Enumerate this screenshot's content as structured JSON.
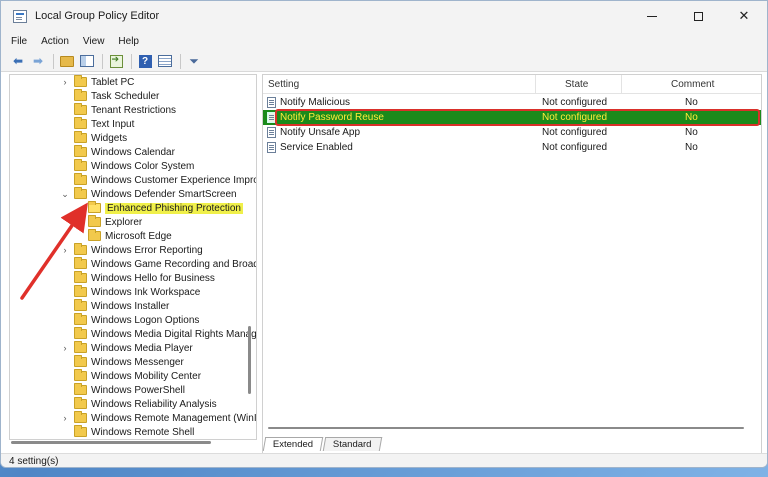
{
  "window": {
    "title": "Local Group Policy Editor",
    "controls": {
      "minimize": "—",
      "maximize": "□",
      "close": "✕"
    }
  },
  "menubar": {
    "items": [
      "File",
      "Action",
      "View",
      "Help"
    ]
  },
  "toolbar": {
    "icons": [
      "back-arrow-icon",
      "forward-arrow-icon",
      "up-folder-icon",
      "show-pane-icon",
      "export-list-icon",
      "help-icon",
      "properties-icon",
      "filter-icon"
    ]
  },
  "tree": {
    "items": [
      {
        "label": "Tablet PC",
        "expander": "›"
      },
      {
        "label": "Task Scheduler",
        "expander": ""
      },
      {
        "label": "Tenant Restrictions",
        "expander": ""
      },
      {
        "label": "Text Input",
        "expander": ""
      },
      {
        "label": "Widgets",
        "expander": ""
      },
      {
        "label": "Windows Calendar",
        "expander": ""
      },
      {
        "label": "Windows Color System",
        "expander": ""
      },
      {
        "label": "Windows Customer Experience Impro",
        "expander": ""
      },
      {
        "label": "Windows Defender SmartScreen",
        "expander": "⌄"
      },
      {
        "label": "Enhanced Phishing Protection",
        "expander": "",
        "selected": true
      },
      {
        "label": "Explorer",
        "expander": ""
      },
      {
        "label": "Microsoft Edge",
        "expander": ""
      },
      {
        "label": "Windows Error Reporting",
        "expander": "›"
      },
      {
        "label": "Windows Game Recording and Broad",
        "expander": ""
      },
      {
        "label": "Windows Hello for Business",
        "expander": ""
      },
      {
        "label": "Windows Ink Workspace",
        "expander": ""
      },
      {
        "label": "Windows Installer",
        "expander": ""
      },
      {
        "label": "Windows Logon Options",
        "expander": ""
      },
      {
        "label": "Windows Media Digital Rights Manag",
        "expander": ""
      },
      {
        "label": "Windows Media Player",
        "expander": "›"
      },
      {
        "label": "Windows Messenger",
        "expander": ""
      },
      {
        "label": "Windows Mobility Center",
        "expander": ""
      },
      {
        "label": "Windows PowerShell",
        "expander": ""
      },
      {
        "label": "Windows Reliability Analysis",
        "expander": ""
      },
      {
        "label": "Windows Remote Management (WinI",
        "expander": "›"
      },
      {
        "label": "Windows Remote Shell",
        "expander": ""
      }
    ]
  },
  "list": {
    "columns": {
      "setting": "Setting",
      "state": "State",
      "comment": "Comment"
    },
    "rows": [
      {
        "setting": "Notify Malicious",
        "state": "Not configured",
        "comment": "No"
      },
      {
        "setting": "Notify Password Reuse",
        "state": "Not configured",
        "comment": "No",
        "highlighted": true
      },
      {
        "setting": "Notify Unsafe App",
        "state": "Not configured",
        "comment": "No"
      },
      {
        "setting": "Service Enabled",
        "state": "Not configured",
        "comment": "No"
      }
    ]
  },
  "tabs": [
    "Extended",
    "Standard"
  ],
  "status": {
    "text": "4 setting(s)"
  },
  "colors": {
    "highlight_row_bg": "#1b8a1b",
    "highlight_row_text": "#ffeb3b",
    "annotation_red": "#e0302a",
    "selected_tree_bg": "#f0f04a"
  }
}
